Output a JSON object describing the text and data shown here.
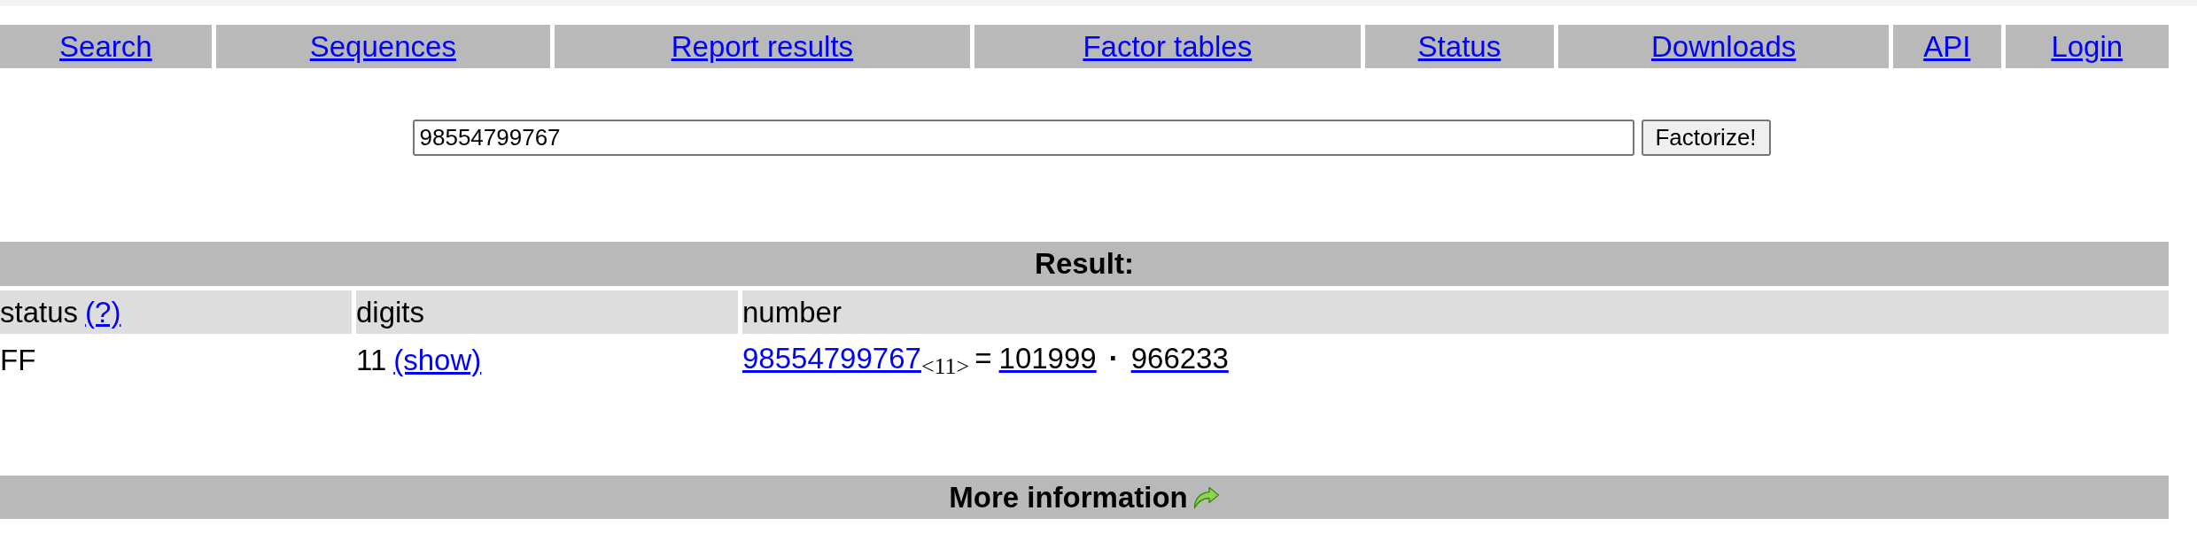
{
  "nav": [
    {
      "label": "Search"
    },
    {
      "label": "Sequences"
    },
    {
      "label": "Report results"
    },
    {
      "label": "Factor tables"
    },
    {
      "label": "Status"
    },
    {
      "label": "Downloads"
    },
    {
      "label": "API"
    },
    {
      "label": "Login"
    }
  ],
  "search": {
    "value": "98554799767",
    "button": "Factorize!"
  },
  "result": {
    "title": "Result:",
    "columns": [
      {
        "label": "status",
        "link": "(?)"
      },
      {
        "label": "digits"
      },
      {
        "label": "number"
      }
    ],
    "rows": [
      {
        "status": "FF",
        "digits": "11",
        "digits_link": "(show)",
        "number": "98554799767",
        "number_digits": "<11>",
        "equals": "=",
        "factors": [
          "101999",
          "966233"
        ],
        "separator": "·"
      }
    ]
  },
  "more_info": {
    "title": "More information"
  }
}
